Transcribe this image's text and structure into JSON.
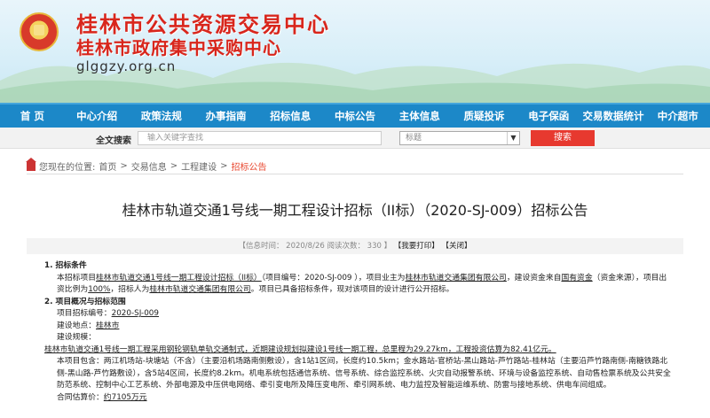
{
  "header": {
    "title1": "桂林市公共资源交易中心",
    "title2": "桂林市政府集中采购中心",
    "url": "glggzy.org.cn"
  },
  "nav": [
    "首 页",
    "中心介绍",
    "政策法规",
    "办事指南",
    "招标信息",
    "中标公告",
    "主体信息",
    "质疑投诉",
    "电子保函",
    "交易数据统计",
    "中介超市"
  ],
  "search": {
    "label": "全文搜索",
    "placeholder": "输入关键字查找",
    "select_value": "标题",
    "button": "搜索"
  },
  "breadcrumb": {
    "prefix": "您现在的位置:",
    "items": [
      "首页",
      "交易信息",
      "工程建设"
    ],
    "current": "招标公告",
    "sep": ">"
  },
  "article": {
    "title": "桂林市轨道交通1号线一期工程设计招标（II标）（2020-SJ-009）招标公告",
    "meta": "【信息时间： 2020/8/26   阅读次数： 330 】",
    "print_label": "【我要打印】",
    "close_label": "【关闭】",
    "s1_title": "1.  招标条件",
    "s1_a": "本招标项目",
    "s1_project": "桂林市轨道交通1号线一期工程设计招标（II标）",
    "s1_b": "（项目编号：2020-SJ-009 ），项目业主为",
    "s1_owner": "桂林市轨道交通集团有限公司",
    "s1_c": "，建设资金来自",
    "s1_fund": "国有资金",
    "s1_d": "（资金来源），项目出资比例为",
    "s1_ratio": "100%",
    "s1_e": "，招标人为",
    "s1_tenderer": "桂林市轨道交通集团有限公司",
    "s1_f": "。项目已具备招标条件，现对该项目的设计进行公开招标。",
    "s2_title": "2.  项目概况与招标范围",
    "code_label": "项目招标编号：",
    "code_value": "2020-SJ-009",
    "loc_label": "建设地点：",
    "loc_value": "桂林市",
    "scale_label": "建设规模：",
    "scale_text": "桂林市轨道交通1号线一期工程采用钢轮钢轨单轨交通制式，近期建设规划拟建设1号线一期工程，总里程为29.27km，工程投资估算为82.41亿元。",
    "scope_text": "本项目包含：两江机场站-块塘站（不含）（主要沿机场路南侧敷设），含1站1区间，长度约10.5km；金水路站-官桥站-黑山路站-芦竹路站-桂林站（主要沿芦竹路南侧-南糖铁路北侧-黑山路-芦竹路敷设），含5站4区间，长度约8.2km。机电系统包括通信系统、信号系统、综合监控系统、火灾自动报警系统、环境与设备监控系统、自动售检票系统及公共安全防范系统、控制中心工艺系统、外部电源及中压供电网络、牵引变电所及降压变电所、牵引网系统、电力监控及智能运维系统、防雷与接地系统、供电车间组成。",
    "price_label": "合同估算价：",
    "price_value": "约7105万元"
  }
}
